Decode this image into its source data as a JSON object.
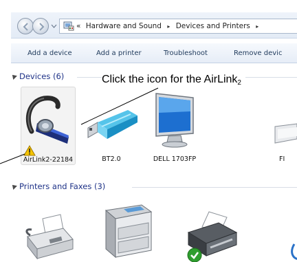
{
  "address_bar": {
    "overflow_glyph": "«",
    "crumbs": [
      "Hardware and Sound",
      "Devices and Printers"
    ],
    "separator": "▸"
  },
  "command_bar": {
    "items": [
      "Add a device",
      "Add a printer",
      "Troubleshoot",
      "Remove devic"
    ]
  },
  "devices_group": {
    "label": "Devices (6)",
    "items": [
      {
        "label": "AirLink2-22184",
        "icon": "bluetooth-headset-icon",
        "warning": true,
        "selected": true
      },
      {
        "label": "BT2.0",
        "icon": "usb-bluetooth-dongle-icon"
      },
      {
        "label": "DELL 1703FP",
        "icon": "monitor-icon"
      },
      {
        "label": "FI",
        "icon": "keyboard-icon"
      }
    ]
  },
  "printers_group": {
    "label": "Printers and Faxes (3)",
    "items": [
      {
        "icon": "fax-machine-icon"
      },
      {
        "icon": "copier-printer-icon"
      },
      {
        "icon": "printer-icon",
        "default": true
      }
    ]
  },
  "annotation": {
    "text": "Click the icon for the AirLink",
    "subscript": "2"
  },
  "colors": {
    "link_blue": "#1e3287",
    "command_text": "#1e395b",
    "warning_yellow": "#f5c400",
    "default_check_green": "#2f9e2f"
  }
}
